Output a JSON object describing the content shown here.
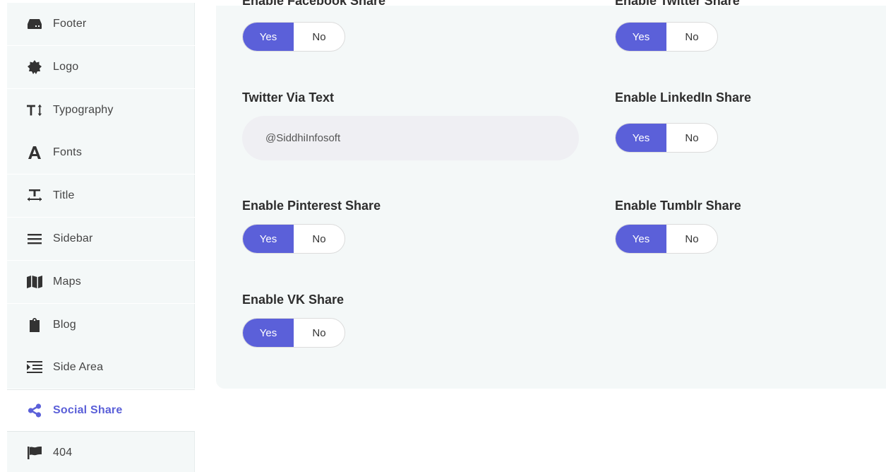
{
  "sidebar": {
    "items": [
      {
        "label": "Footer",
        "icon": "footer-icon"
      },
      {
        "label": "Logo",
        "icon": "logo-icon"
      },
      {
        "label": "Typography",
        "icon": "typography-icon"
      },
      {
        "label": "Fonts",
        "icon": "font-icon"
      },
      {
        "label": "Title",
        "icon": "title-icon"
      },
      {
        "label": "Sidebar",
        "icon": "menu-icon"
      },
      {
        "label": "Maps",
        "icon": "map-icon"
      },
      {
        "label": "Blog",
        "icon": "clipboard-icon"
      },
      {
        "label": "Side Area",
        "icon": "indent-icon"
      },
      {
        "label": "Social Share",
        "icon": "share-icon",
        "active": true
      },
      {
        "label": "404",
        "icon": "flag-icon"
      }
    ]
  },
  "settings": {
    "facebook": {
      "label": "Enable Facebook Share",
      "yes": "Yes",
      "no": "No",
      "value": "Yes"
    },
    "twitter": {
      "label": "Enable Twitter Share",
      "yes": "Yes",
      "no": "No",
      "value": "Yes"
    },
    "twitter_via": {
      "label": "Twitter Via Text",
      "value": "@SiddhiInfosoft"
    },
    "linkedin": {
      "label": "Enable LinkedIn Share",
      "yes": "Yes",
      "no": "No",
      "value": "Yes"
    },
    "pinterest": {
      "label": "Enable Pinterest Share",
      "yes": "Yes",
      "no": "No",
      "value": "Yes"
    },
    "tumblr": {
      "label": "Enable Tumblr Share",
      "yes": "Yes",
      "no": "No",
      "value": "Yes"
    },
    "vk": {
      "label": "Enable VK Share",
      "yes": "Yes",
      "no": "No",
      "value": "Yes"
    }
  },
  "colors": {
    "accent": "#5b60d9",
    "panel_bg": "#f4f8f8",
    "input_bg": "#efeff3"
  }
}
